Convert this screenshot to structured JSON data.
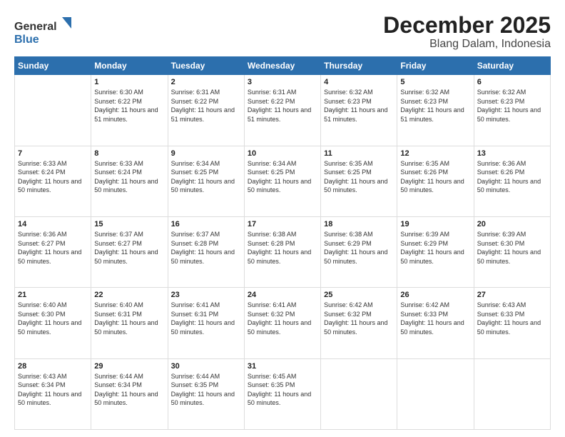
{
  "logo": {
    "line1": "General",
    "line2": "Blue"
  },
  "title": "December 2025",
  "subtitle": "Blang Dalam, Indonesia",
  "days_of_week": [
    "Sunday",
    "Monday",
    "Tuesday",
    "Wednesday",
    "Thursday",
    "Friday",
    "Saturday"
  ],
  "weeks": [
    [
      {
        "day": "",
        "sunrise": "",
        "sunset": "",
        "daylight": ""
      },
      {
        "day": "1",
        "sunrise": "6:30 AM",
        "sunset": "6:22 PM",
        "daylight": "11 hours and 51 minutes."
      },
      {
        "day": "2",
        "sunrise": "6:31 AM",
        "sunset": "6:22 PM",
        "daylight": "11 hours and 51 minutes."
      },
      {
        "day": "3",
        "sunrise": "6:31 AM",
        "sunset": "6:22 PM",
        "daylight": "11 hours and 51 minutes."
      },
      {
        "day": "4",
        "sunrise": "6:32 AM",
        "sunset": "6:23 PM",
        "daylight": "11 hours and 51 minutes."
      },
      {
        "day": "5",
        "sunrise": "6:32 AM",
        "sunset": "6:23 PM",
        "daylight": "11 hours and 51 minutes."
      },
      {
        "day": "6",
        "sunrise": "6:32 AM",
        "sunset": "6:23 PM",
        "daylight": "11 hours and 50 minutes."
      }
    ],
    [
      {
        "day": "7",
        "sunrise": "6:33 AM",
        "sunset": "6:24 PM",
        "daylight": "11 hours and 50 minutes."
      },
      {
        "day": "8",
        "sunrise": "6:33 AM",
        "sunset": "6:24 PM",
        "daylight": "11 hours and 50 minutes."
      },
      {
        "day": "9",
        "sunrise": "6:34 AM",
        "sunset": "6:25 PM",
        "daylight": "11 hours and 50 minutes."
      },
      {
        "day": "10",
        "sunrise": "6:34 AM",
        "sunset": "6:25 PM",
        "daylight": "11 hours and 50 minutes."
      },
      {
        "day": "11",
        "sunrise": "6:35 AM",
        "sunset": "6:25 PM",
        "daylight": "11 hours and 50 minutes."
      },
      {
        "day": "12",
        "sunrise": "6:35 AM",
        "sunset": "6:26 PM",
        "daylight": "11 hours and 50 minutes."
      },
      {
        "day": "13",
        "sunrise": "6:36 AM",
        "sunset": "6:26 PM",
        "daylight": "11 hours and 50 minutes."
      }
    ],
    [
      {
        "day": "14",
        "sunrise": "6:36 AM",
        "sunset": "6:27 PM",
        "daylight": "11 hours and 50 minutes."
      },
      {
        "day": "15",
        "sunrise": "6:37 AM",
        "sunset": "6:27 PM",
        "daylight": "11 hours and 50 minutes."
      },
      {
        "day": "16",
        "sunrise": "6:37 AM",
        "sunset": "6:28 PM",
        "daylight": "11 hours and 50 minutes."
      },
      {
        "day": "17",
        "sunrise": "6:38 AM",
        "sunset": "6:28 PM",
        "daylight": "11 hours and 50 minutes."
      },
      {
        "day": "18",
        "sunrise": "6:38 AM",
        "sunset": "6:29 PM",
        "daylight": "11 hours and 50 minutes."
      },
      {
        "day": "19",
        "sunrise": "6:39 AM",
        "sunset": "6:29 PM",
        "daylight": "11 hours and 50 minutes."
      },
      {
        "day": "20",
        "sunrise": "6:39 AM",
        "sunset": "6:30 PM",
        "daylight": "11 hours and 50 minutes."
      }
    ],
    [
      {
        "day": "21",
        "sunrise": "6:40 AM",
        "sunset": "6:30 PM",
        "daylight": "11 hours and 50 minutes."
      },
      {
        "day": "22",
        "sunrise": "6:40 AM",
        "sunset": "6:31 PM",
        "daylight": "11 hours and 50 minutes."
      },
      {
        "day": "23",
        "sunrise": "6:41 AM",
        "sunset": "6:31 PM",
        "daylight": "11 hours and 50 minutes."
      },
      {
        "day": "24",
        "sunrise": "6:41 AM",
        "sunset": "6:32 PM",
        "daylight": "11 hours and 50 minutes."
      },
      {
        "day": "25",
        "sunrise": "6:42 AM",
        "sunset": "6:32 PM",
        "daylight": "11 hours and 50 minutes."
      },
      {
        "day": "26",
        "sunrise": "6:42 AM",
        "sunset": "6:33 PM",
        "daylight": "11 hours and 50 minutes."
      },
      {
        "day": "27",
        "sunrise": "6:43 AM",
        "sunset": "6:33 PM",
        "daylight": "11 hours and 50 minutes."
      }
    ],
    [
      {
        "day": "28",
        "sunrise": "6:43 AM",
        "sunset": "6:34 PM",
        "daylight": "11 hours and 50 minutes."
      },
      {
        "day": "29",
        "sunrise": "6:44 AM",
        "sunset": "6:34 PM",
        "daylight": "11 hours and 50 minutes."
      },
      {
        "day": "30",
        "sunrise": "6:44 AM",
        "sunset": "6:35 PM",
        "daylight": "11 hours and 50 minutes."
      },
      {
        "day": "31",
        "sunrise": "6:45 AM",
        "sunset": "6:35 PM",
        "daylight": "11 hours and 50 minutes."
      },
      {
        "day": "",
        "sunrise": "",
        "sunset": "",
        "daylight": ""
      },
      {
        "day": "",
        "sunrise": "",
        "sunset": "",
        "daylight": ""
      },
      {
        "day": "",
        "sunrise": "",
        "sunset": "",
        "daylight": ""
      }
    ]
  ],
  "labels": {
    "sunrise_prefix": "Sunrise: ",
    "sunset_prefix": "Sunset: ",
    "daylight_prefix": "Daylight: "
  }
}
